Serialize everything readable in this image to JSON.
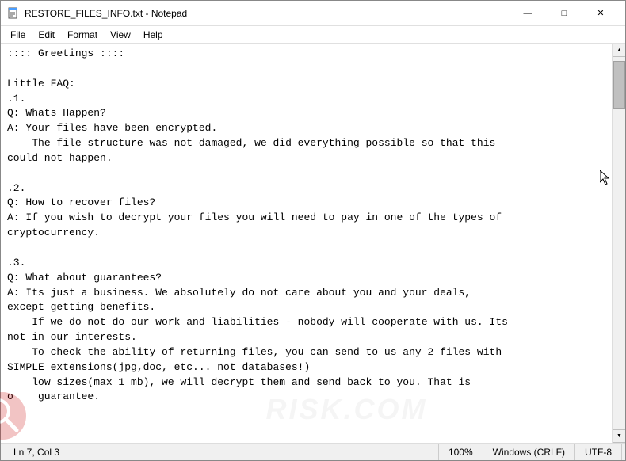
{
  "window": {
    "title": "RESTORE_FILES_INFO.txt - Notepad",
    "icon": "notepad"
  },
  "title_bar": {
    "minimize_label": "—",
    "maximize_label": "□",
    "close_label": "✕"
  },
  "menu": {
    "items": [
      "File",
      "Edit",
      "Format",
      "View",
      "Help"
    ]
  },
  "content": ":::: Greetings ::::\n\nLittle FAQ:\n.1.\nQ: Whats Happen?\nA: Your files have been encrypted.\n    The file structure was not damaged, we did everything possible so that this\ncould not happen.\n\n.2.\nQ: How to recover files?\nA: If you wish to decrypt your files you will need to pay in one of the types of\ncryptocurrency.\n\n.3.\nQ: What about guarantees?\nA: Its just a business. We absolutely do not care about you and your deals,\nexcept getting benefits.\n    If we do not do our work and liabilities - nobody will cooperate with us. Its\nnot in our interests.\n    To check the ability of returning files, you can send to us any 2 files with\nSIMPLE extensions(jpg,doc, etc... not databases!)\n    low sizes(max 1 mb), we will decrypt them and send back to you. That is\no    guarantee.",
  "status_bar": {
    "position": "Ln 7, Col 3",
    "zoom": "100%",
    "line_ending": "Windows (CRLF)",
    "encoding": "UTF-8"
  }
}
